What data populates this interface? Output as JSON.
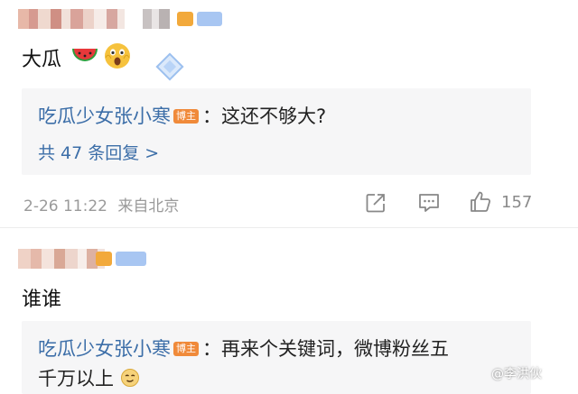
{
  "comment1": {
    "text": "大瓜",
    "emoji_1": "watermelon-emoji",
    "emoji_2": "shocked-face-emoji",
    "reply": {
      "name": "吃瓜少女张小寒",
      "host_tag": "博主",
      "text": "：这还不够大?"
    },
    "more_replies": "共 47 条回复 >",
    "timestamp": "2-26 11:22",
    "location": "来自北京",
    "like_count": "157"
  },
  "comment2": {
    "text": "谁谁",
    "reply": {
      "name": "吃瓜少女张小寒",
      "host_tag": "博主",
      "text": "：再来个关键词，微博粉丝五",
      "text_line2": "千万以上"
    }
  },
  "watermark": {
    "text": "@李洪伙"
  },
  "colors": {
    "link": "#3c6ea8",
    "host_tag": "#f08a3a",
    "meta": "#9a9a9a",
    "reply_bg": "#f6f6f7"
  }
}
